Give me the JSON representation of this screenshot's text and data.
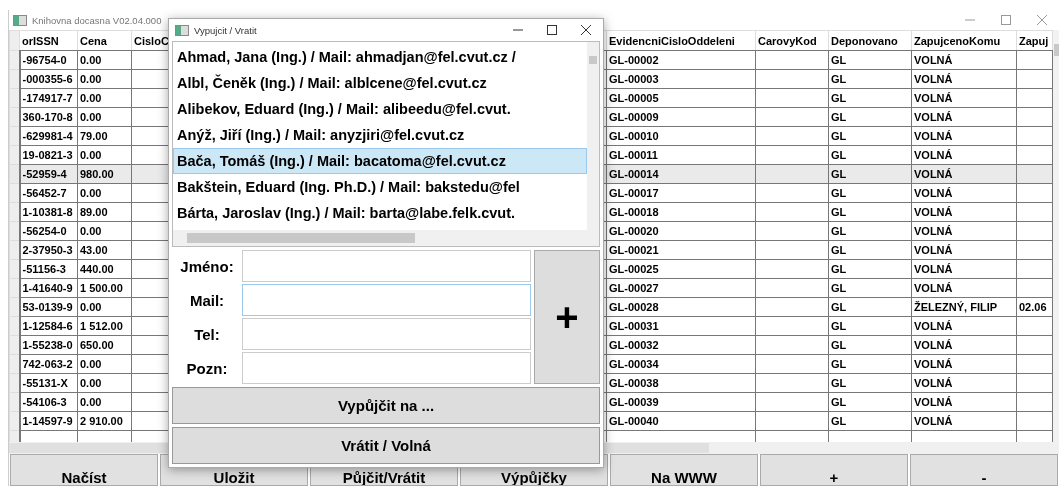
{
  "main_window": {
    "title": "Knihovna docasna V02.04.000"
  },
  "table": {
    "columns": [
      "orISSN",
      "Cena",
      "CisloC",
      "EvidencniCisloOddeleni",
      "CarovyKod",
      "Deponovano",
      "ZapujcenoKomu",
      "Zapuj"
    ],
    "rows": [
      {
        "issn": "-96754-0",
        "cena": "0.00",
        "evidencni": "GL-00002",
        "deponovano": "GL",
        "zapujceno_komu": "VOLNÁ",
        "selected": false
      },
      {
        "issn": "-000355-6",
        "cena": "0.00",
        "evidencni": "GL-00003",
        "deponovano": "GL",
        "zapujceno_komu": "VOLNÁ",
        "selected": false
      },
      {
        "issn": "-174917-7",
        "cena": "0.00",
        "evidencni": "GL-00005",
        "deponovano": "GL",
        "zapujceno_komu": "VOLNÁ",
        "selected": false
      },
      {
        "issn": "360-170-8",
        "cena": "0.00",
        "evidencni": "GL-00009",
        "deponovano": "GL",
        "zapujceno_komu": "VOLNÁ",
        "selected": false
      },
      {
        "issn": "-629981-4",
        "cena": "79.00",
        "evidencni": "GL-00010",
        "deponovano": "GL",
        "zapujceno_komu": "VOLNÁ",
        "selected": false
      },
      {
        "issn": "19-0821-3",
        "cena": "0.00",
        "evidencni": "GL-00011",
        "deponovano": "GL",
        "zapujceno_komu": "VOLNÁ",
        "selected": false
      },
      {
        "issn": "-52959-4",
        "cena": "980.00",
        "evidencni": "GL-00014",
        "deponovano": "GL",
        "zapujceno_komu": "VOLNÁ",
        "selected": true
      },
      {
        "issn": "-56452-7",
        "cena": "0.00",
        "evidencni": "GL-00017",
        "deponovano": "GL",
        "zapujceno_komu": "VOLNÁ",
        "selected": false
      },
      {
        "issn": "1-10381-8",
        "cena": "89.00",
        "evidencni": "GL-00018",
        "deponovano": "GL",
        "zapujceno_komu": "VOLNÁ",
        "selected": false
      },
      {
        "issn": "-56254-0",
        "cena": "0.00",
        "evidencni": "GL-00020",
        "deponovano": "GL",
        "zapujceno_komu": "VOLNÁ",
        "selected": false
      },
      {
        "issn": "2-37950-3",
        "cena": "43.00",
        "evidencni": "GL-00021",
        "deponovano": "GL",
        "zapujceno_komu": "VOLNÁ",
        "selected": false
      },
      {
        "issn": "-51156-3",
        "cena": "440.00",
        "evidencni": "GL-00025",
        "deponovano": "GL",
        "zapujceno_komu": "VOLNÁ",
        "selected": false
      },
      {
        "issn": "1-41640-9",
        "cena": "1 500.00",
        "evidencni": "GL-00027",
        "deponovano": "GL",
        "zapujceno_komu": "VOLNÁ",
        "selected": false
      },
      {
        "issn": "53-0139-9",
        "cena": "0.00",
        "evidencni": "GL-00028",
        "deponovano": "GL",
        "zapujceno_komu": "ŽELEZNÝ, FILIP",
        "zapuj": "02.06",
        "selected": false
      },
      {
        "issn": "1-12584-6",
        "cena": "1 512.00",
        "evidencni": "GL-00031",
        "deponovano": "GL",
        "zapujceno_komu": "VOLNÁ",
        "selected": false
      },
      {
        "issn": "1-55238-0",
        "cena": "650.00",
        "evidencni": "GL-00032",
        "deponovano": "GL",
        "zapujceno_komu": "VOLNÁ",
        "selected": false
      },
      {
        "issn": "742-063-2",
        "cena": "0.00",
        "evidencni": "GL-00034",
        "deponovano": "GL",
        "zapujceno_komu": "VOLNÁ",
        "selected": false
      },
      {
        "issn": "-55131-X",
        "cena": "0.00",
        "evidencni": "GL-00038",
        "deponovano": "GL",
        "zapujceno_komu": "VOLNÁ",
        "selected": false
      },
      {
        "issn": "-54106-3",
        "cena": "0.00",
        "evidencni": "GL-00039",
        "deponovano": "GL",
        "zapujceno_komu": "VOLNÁ",
        "selected": false
      },
      {
        "issn": "1-14597-9",
        "cena": "2 910.00",
        "evidencni": "GL-00040",
        "deponovano": "GL",
        "zapujceno_komu": "VOLNÁ",
        "selected": false
      }
    ]
  },
  "buttons": [
    "Načíst",
    "Uložit",
    "Půjčit/Vrátit",
    "Výpůjčky",
    "Na WWW",
    "+",
    "-"
  ],
  "dialog": {
    "title": "Vypujcit / Vratit",
    "people": [
      {
        "label": "Ahmad, Jana (Ing.) / Mail: ahmadjan@fel.cvut.cz /",
        "selected": false
      },
      {
        "label": "Albl, Čeněk (Ing.) / Mail: alblcene@fel.cvut.cz",
        "selected": false
      },
      {
        "label": "Alibekov, Eduard (Ing.) / Mail: alibeedu@fel.cvut.",
        "selected": false
      },
      {
        "label": "Anýž, Jiří (Ing.) / Mail: anyzjiri@fel.cvut.cz",
        "selected": false
      },
      {
        "label": "Bača, Tomáš (Ing.) / Mail: bacatoma@fel.cvut.cz",
        "selected": true
      },
      {
        "label": "Bakštein, Eduard (Ing. Ph.D.) / Mail: bakstedu@fel",
        "selected": false
      },
      {
        "label": "Bárta, Jaroslav (Ing.) / Mail: barta@labe.felk.cvut.",
        "selected": false
      }
    ],
    "fields": [
      {
        "label": "Jméno:",
        "focused": false
      },
      {
        "label": "Mail:",
        "focused": true
      },
      {
        "label": "Tel:",
        "focused": false
      },
      {
        "label": "Pozn:",
        "focused": false
      }
    ],
    "add_button": "+",
    "actions": [
      "Vypůjčit na ...",
      "Vrátit / Volná"
    ]
  }
}
